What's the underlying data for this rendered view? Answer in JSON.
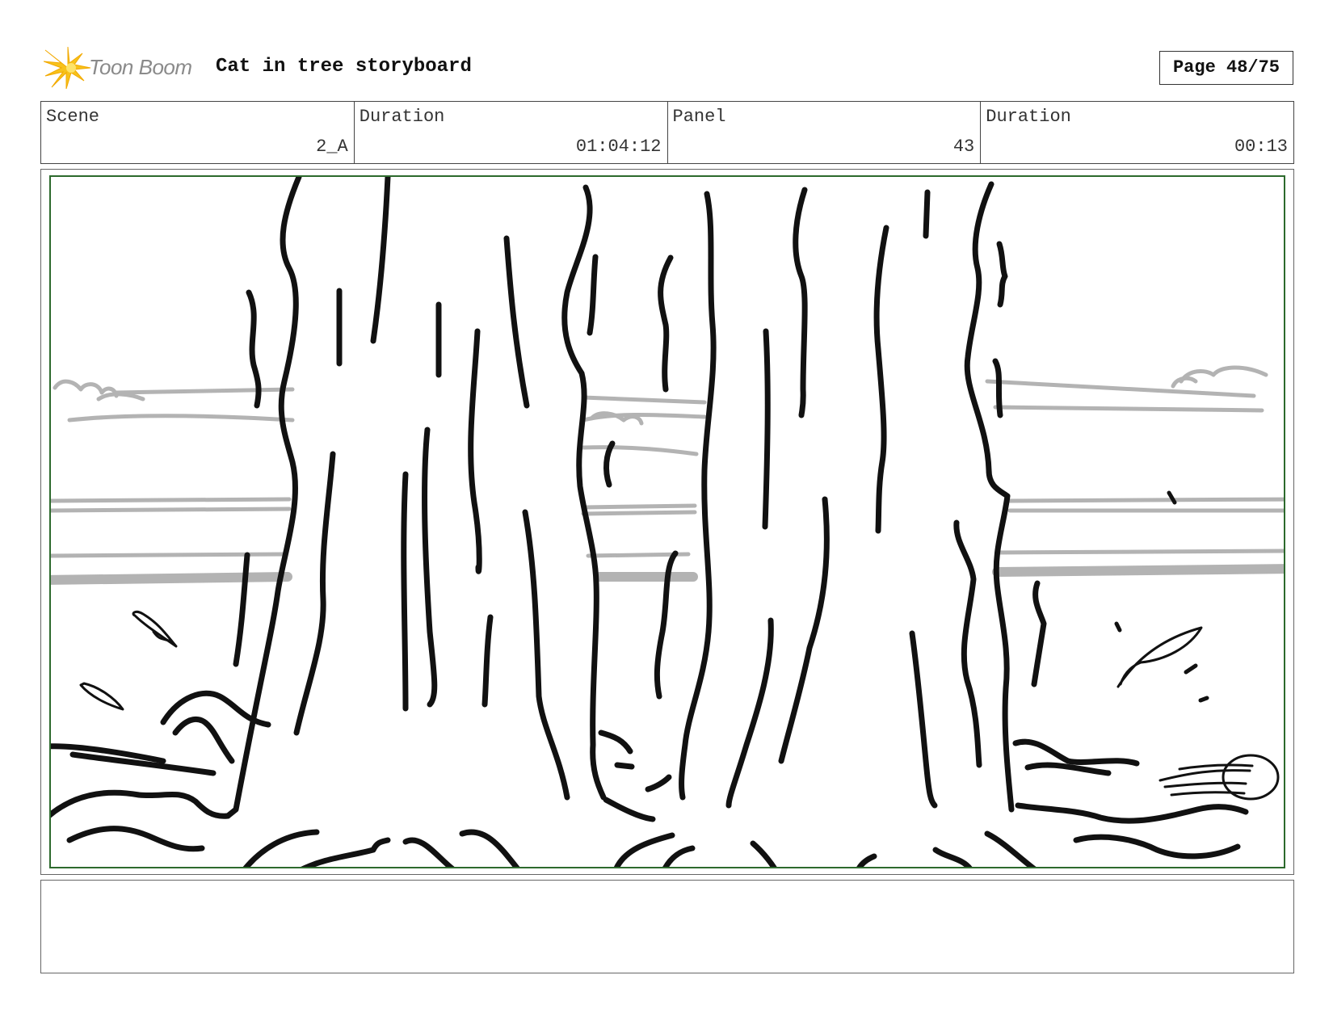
{
  "header": {
    "logo_text": "Toon Boom",
    "title": "Cat in tree storyboard",
    "page": "Page 48/75"
  },
  "info": {
    "scene_label": "Scene",
    "scene_value": "2_A",
    "scene_duration_label": "Duration",
    "scene_duration_value": "01:04:12",
    "panel_label": "Panel",
    "panel_value": "43",
    "panel_duration_label": "Duration",
    "panel_duration_value": "00:13"
  },
  "colors": {
    "frame_border": "#2d6a2d",
    "logo_yellow": "#f5c518",
    "sketch_black": "#111111",
    "sketch_gray": "#b3b3b3"
  },
  "icons": [
    "toon-boom-logo-icon"
  ],
  "notes": ""
}
